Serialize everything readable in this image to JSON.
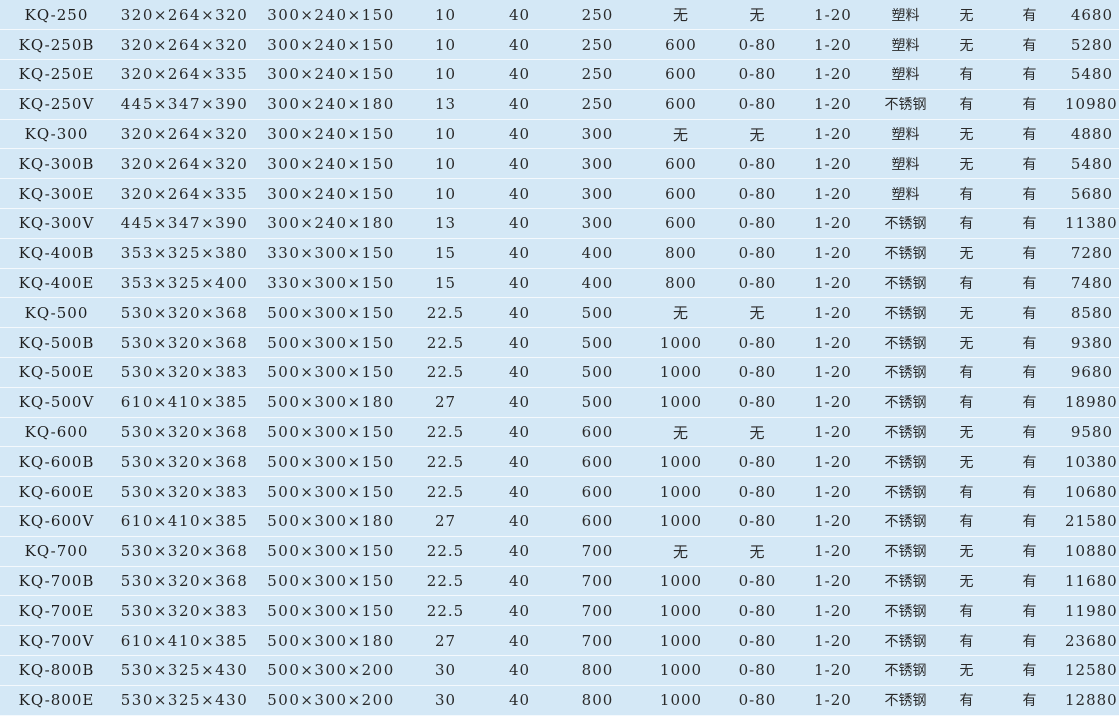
{
  "table": {
    "rows": [
      [
        "KQ-250",
        "320×264×320",
        "300×240×150",
        "10",
        "40",
        "250",
        "无",
        "无",
        "1-20",
        "塑料",
        "无",
        "有",
        "4680"
      ],
      [
        "KQ-250B",
        "320×264×320",
        "300×240×150",
        "10",
        "40",
        "250",
        "600",
        "0-80",
        "1-20",
        "塑料",
        "无",
        "有",
        "5280"
      ],
      [
        "KQ-250E",
        "320×264×335",
        "300×240×150",
        "10",
        "40",
        "250",
        "600",
        "0-80",
        "1-20",
        "塑料",
        "有",
        "有",
        "5480"
      ],
      [
        "KQ-250V",
        "445×347×390",
        "300×240×180",
        "13",
        "40",
        "250",
        "600",
        "0-80",
        "1-20",
        "不锈钢",
        "有",
        "有",
        "10980"
      ],
      [
        "KQ-300",
        "320×264×320",
        "300×240×150",
        "10",
        "40",
        "300",
        "无",
        "无",
        "1-20",
        "塑料",
        "无",
        "有",
        "4880"
      ],
      [
        "KQ-300B",
        "320×264×320",
        "300×240×150",
        "10",
        "40",
        "300",
        "600",
        "0-80",
        "1-20",
        "塑料",
        "无",
        "有",
        "5480"
      ],
      [
        "KQ-300E",
        "320×264×335",
        "300×240×150",
        "10",
        "40",
        "300",
        "600",
        "0-80",
        "1-20",
        "塑料",
        "有",
        "有",
        "5680"
      ],
      [
        "KQ-300V",
        "445×347×390",
        "300×240×180",
        "13",
        "40",
        "300",
        "600",
        "0-80",
        "1-20",
        "不锈钢",
        "有",
        "有",
        "11380"
      ],
      [
        "KQ-400B",
        "353×325×380",
        "330×300×150",
        "15",
        "40",
        "400",
        "800",
        "0-80",
        "1-20",
        "不锈钢",
        "无",
        "有",
        "7280"
      ],
      [
        "KQ-400E",
        "353×325×400",
        "330×300×150",
        "15",
        "40",
        "400",
        "800",
        "0-80",
        "1-20",
        "不锈钢",
        "有",
        "有",
        "7480"
      ],
      [
        "KQ-500",
        "530×320×368",
        "500×300×150",
        "22.5",
        "40",
        "500",
        "无",
        "无",
        "1-20",
        "不锈钢",
        "无",
        "有",
        "8580"
      ],
      [
        "KQ-500B",
        "530×320×368",
        "500×300×150",
        "22.5",
        "40",
        "500",
        "1000",
        "0-80",
        "1-20",
        "不锈钢",
        "无",
        "有",
        "9380"
      ],
      [
        "KQ-500E",
        "530×320×383",
        "500×300×150",
        "22.5",
        "40",
        "500",
        "1000",
        "0-80",
        "1-20",
        "不锈钢",
        "有",
        "有",
        "9680"
      ],
      [
        "KQ-500V",
        "610×410×385",
        "500×300×180",
        "27",
        "40",
        "500",
        "1000",
        "0-80",
        "1-20",
        "不锈钢",
        "有",
        "有",
        "18980"
      ],
      [
        "KQ-600",
        "530×320×368",
        "500×300×150",
        "22.5",
        "40",
        "600",
        "无",
        "无",
        "1-20",
        "不锈钢",
        "无",
        "有",
        "9580"
      ],
      [
        "KQ-600B",
        "530×320×368",
        "500×300×150",
        "22.5",
        "40",
        "600",
        "1000",
        "0-80",
        "1-20",
        "不锈钢",
        "无",
        "有",
        "10380"
      ],
      [
        "KQ-600E",
        "530×320×383",
        "500×300×150",
        "22.5",
        "40",
        "600",
        "1000",
        "0-80",
        "1-20",
        "不锈钢",
        "有",
        "有",
        "10680"
      ],
      [
        "KQ-600V",
        "610×410×385",
        "500×300×180",
        "27",
        "40",
        "600",
        "1000",
        "0-80",
        "1-20",
        "不锈钢",
        "有",
        "有",
        "21580"
      ],
      [
        "KQ-700",
        "530×320×368",
        "500×300×150",
        "22.5",
        "40",
        "700",
        "无",
        "无",
        "1-20",
        "不锈钢",
        "无",
        "有",
        "10880"
      ],
      [
        "KQ-700B",
        "530×320×368",
        "500×300×150",
        "22.5",
        "40",
        "700",
        "1000",
        "0-80",
        "1-20",
        "不锈钢",
        "无",
        "有",
        "11680"
      ],
      [
        "KQ-700E",
        "530×320×383",
        "500×300×150",
        "22.5",
        "40",
        "700",
        "1000",
        "0-80",
        "1-20",
        "不锈钢",
        "有",
        "有",
        "11980"
      ],
      [
        "KQ-700V",
        "610×410×385",
        "500×300×180",
        "27",
        "40",
        "700",
        "1000",
        "0-80",
        "1-20",
        "不锈钢",
        "有",
        "有",
        "23680"
      ],
      [
        "KQ-800B",
        "530×325×430",
        "500×300×200",
        "30",
        "40",
        "800",
        "1000",
        "0-80",
        "1-20",
        "不锈钢",
        "无",
        "有",
        "12580"
      ],
      [
        "KQ-800E",
        "530×325×430",
        "500×300×200",
        "30",
        "40",
        "800",
        "1000",
        "0-80",
        "1-20",
        "不锈钢",
        "有",
        "有",
        "12880"
      ]
    ]
  },
  "colors": {
    "row_background": "#d4e8f6",
    "row_divider": "#f4f9fd",
    "text": "#2a2a2a"
  }
}
